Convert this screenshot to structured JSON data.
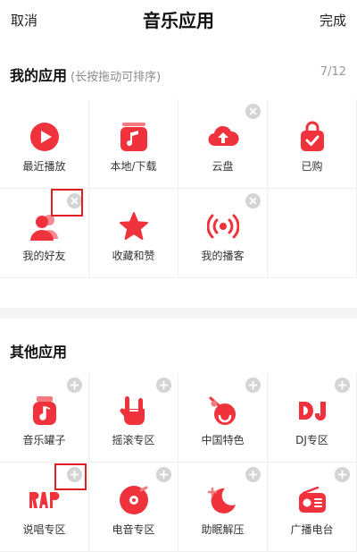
{
  "header": {
    "cancel": "取消",
    "title": "音乐应用",
    "done": "完成"
  },
  "my_apps": {
    "title": "我的应用",
    "hint": "(长按拖动可排序)",
    "count": "7/12",
    "items": [
      {
        "label": "最近播放",
        "icon": "play-circle-icon",
        "badge": "none"
      },
      {
        "label": "本地/下载",
        "icon": "music-note-icon",
        "badge": "none"
      },
      {
        "label": "云盘",
        "icon": "cloud-upload-icon",
        "badge": "remove"
      },
      {
        "label": "已购",
        "icon": "shopping-bag-icon",
        "badge": "none"
      },
      {
        "label": "我的好友",
        "icon": "friends-icon",
        "badge": "remove"
      },
      {
        "label": "收藏和赞",
        "icon": "star-icon",
        "badge": "none"
      },
      {
        "label": "我的播客",
        "icon": "podcast-broadcast-icon",
        "badge": "remove"
      }
    ]
  },
  "other_apps": {
    "title": "其他应用",
    "items": [
      {
        "label": "音乐罐子",
        "icon": "music-jar-icon",
        "badge": "add"
      },
      {
        "label": "摇滚专区",
        "icon": "rock-hand-icon",
        "badge": "add"
      },
      {
        "label": "中国特色",
        "icon": "chinese-drum-icon",
        "badge": "add"
      },
      {
        "label": "DJ专区",
        "icon": "dj-text-icon",
        "badge": "add"
      },
      {
        "label": "说唱专区",
        "icon": "rap-text-icon",
        "badge": "add"
      },
      {
        "label": "电音专区",
        "icon": "vinyl-disc-icon",
        "badge": "add"
      },
      {
        "label": "助眠解压",
        "icon": "moon-sleep-icon",
        "badge": "add"
      },
      {
        "label": "广播电台",
        "icon": "radio-icon",
        "badge": "add"
      }
    ]
  },
  "colors": {
    "accent": "#f0323c",
    "badge": "#d4d4d4",
    "highlight": "#e02020"
  }
}
